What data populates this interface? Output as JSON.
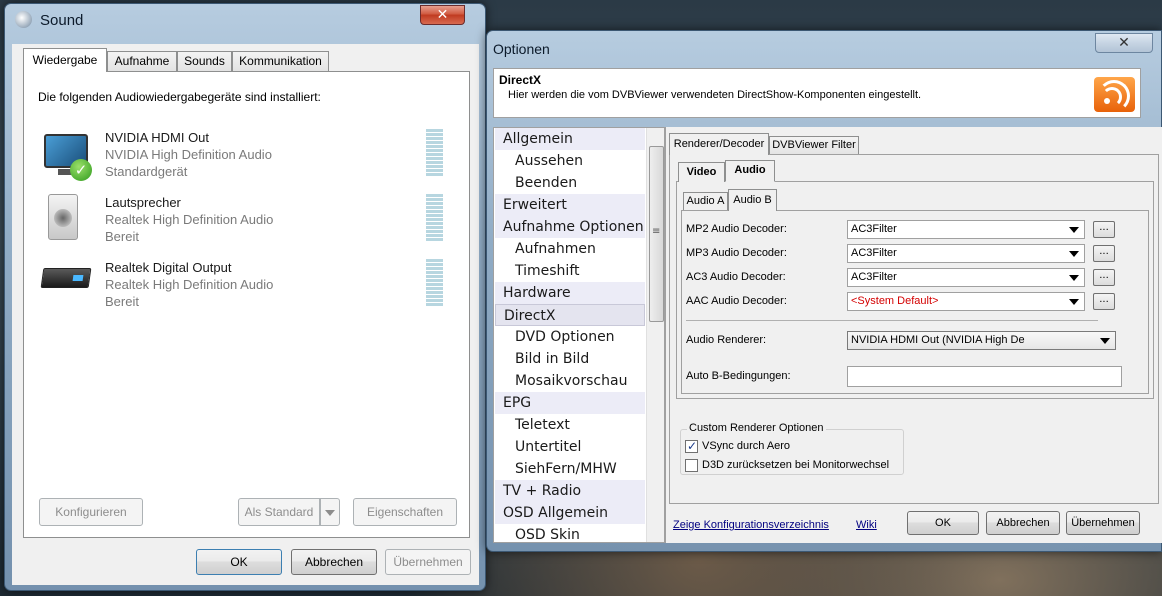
{
  "sound_window": {
    "title": "Sound",
    "close_label": "✕",
    "tabs": [
      "Wiedergabe",
      "Aufnahme",
      "Sounds",
      "Kommunikation"
    ],
    "intro": "Die folgenden Audiowiedergabegeräte sind installiert:",
    "devices": [
      {
        "name": "NVIDIA HDMI Out",
        "driver": "NVIDIA High Definition Audio",
        "status": "Standardgerät",
        "icon": "monitor-icon",
        "default": true
      },
      {
        "name": "Lautsprecher",
        "driver": "Realtek High Definition Audio",
        "status": "Bereit",
        "icon": "speaker-icon",
        "default": false
      },
      {
        "name": "Realtek Digital Output",
        "driver": "Realtek High Definition Audio",
        "status": "Bereit",
        "icon": "digital-output-icon",
        "default": false
      }
    ],
    "buttons": {
      "configure": "Konfigurieren",
      "set_default": "Als Standard",
      "properties": "Eigenschaften",
      "ok": "OK",
      "cancel": "Abbrechen",
      "apply": "Übernehmen"
    }
  },
  "options_window": {
    "title": "Optionen",
    "close_label": "✕",
    "header_title": "DirectX",
    "header_desc": "Hier werden die vom DVBViewer verwendeten DirectShow-Komponenten eingestellt.",
    "nav": [
      {
        "label": "Allgemein",
        "kind": "cat"
      },
      {
        "label": "Aussehen",
        "kind": "sub"
      },
      {
        "label": "Beenden",
        "kind": "sub"
      },
      {
        "label": "Erweitert",
        "kind": "cat"
      },
      {
        "label": "Aufnahme Optionen",
        "kind": "cat"
      },
      {
        "label": "Aufnahmen",
        "kind": "sub"
      },
      {
        "label": "Timeshift",
        "kind": "sub"
      },
      {
        "label": "Hardware",
        "kind": "cat"
      },
      {
        "label": "DirectX",
        "kind": "cat",
        "selected": true
      },
      {
        "label": "DVD Optionen",
        "kind": "sub"
      },
      {
        "label": "Bild in Bild",
        "kind": "sub"
      },
      {
        "label": "Mosaikvorschau",
        "kind": "sub"
      },
      {
        "label": "EPG",
        "kind": "cat"
      },
      {
        "label": "Teletext",
        "kind": "sub"
      },
      {
        "label": "Untertitel",
        "kind": "sub"
      },
      {
        "label": "SiehFern/MHW",
        "kind": "sub"
      },
      {
        "label": "TV + Radio",
        "kind": "cat"
      },
      {
        "label": "OSD Allgemein",
        "kind": "cat"
      },
      {
        "label": "OSD Skin",
        "kind": "sub"
      }
    ],
    "top_tabs": [
      "Renderer/Decoder",
      "DVBViewer Filter"
    ],
    "mid_tabs": [
      "Video",
      "Audio"
    ],
    "inner_tabs": [
      "Audio A",
      "Audio B"
    ],
    "decoders": [
      {
        "label": "MP2 Audio Decoder:",
        "value": "AC3Filter",
        "warn": false
      },
      {
        "label": "MP3 Audio Decoder:",
        "value": "AC3Filter",
        "warn": false
      },
      {
        "label": "AC3 Audio Decoder:",
        "value": "AC3Filter",
        "warn": false
      },
      {
        "label": "AAC Audio Decoder:",
        "value": "<System Default>",
        "warn": true
      }
    ],
    "dots_label": "...",
    "audio_renderer_label": "Audio Renderer:",
    "audio_renderer_value": "NVIDIA HDMI Out (NVIDIA High De",
    "auto_b_label": "Auto B-Bedingungen:",
    "auto_b_value": "",
    "custom_group_title": "Custom Renderer Optionen",
    "checks": [
      {
        "label": "VSync durch Aero",
        "checked": true
      },
      {
        "label": "D3D zurücksetzen bei Monitorwechsel",
        "checked": false
      }
    ],
    "links": {
      "config_dir": "Zeige Konfigurationsverzeichnis",
      "wiki": "Wiki"
    },
    "buttons": {
      "ok": "OK",
      "cancel": "Abbrechen",
      "apply": "Übernehmen"
    },
    "colors": {
      "warn": "#d40000",
      "link": "#000080",
      "accent_orange": "#f07a1a"
    }
  }
}
